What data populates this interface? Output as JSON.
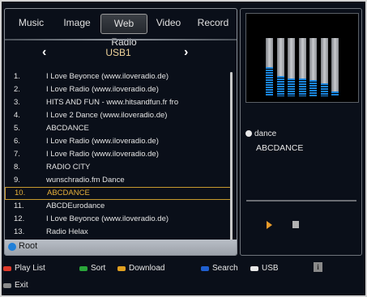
{
  "tabs": [
    {
      "label": "Music"
    },
    {
      "label": "Image"
    },
    {
      "label": "Web Radio"
    },
    {
      "label": "Video"
    },
    {
      "label": "Record"
    }
  ],
  "active_tab": "Web Radio",
  "source": {
    "label": "USB1"
  },
  "list": [
    {
      "num": "1.",
      "title": "I Love Beyonce (www.iloveradio.de)"
    },
    {
      "num": "2.",
      "title": "I Love Radio (www.iloveradio.de)"
    },
    {
      "num": "3.",
      "title": "HITS AND FUN - www.hitsandfun.fr fro"
    },
    {
      "num": "4.",
      "title": "I Love 2 Dance (www.iloveradio.de)"
    },
    {
      "num": "5.",
      "title": "ABCDANCE"
    },
    {
      "num": "6.",
      "title": "I Love Radio (www.iloveradio.de)"
    },
    {
      "num": "7.",
      "title": "I Love Radio (www.iloveradio.de)"
    },
    {
      "num": "8.",
      "title": "RADIO CITY"
    },
    {
      "num": "9.",
      "title": "wunschradio.fm Dance"
    },
    {
      "num": "10.",
      "title": "ABCDANCE"
    },
    {
      "num": "11.",
      "title": "ABCDEurodance"
    },
    {
      "num": "12.",
      "title": "I Love Beyonce (www.iloveradio.de)"
    },
    {
      "num": "13.",
      "title": "Radio Helax"
    }
  ],
  "selected_index": 9,
  "path": {
    "label": "Root"
  },
  "now_playing": {
    "label": "dance",
    "title": "ABCDANCE"
  },
  "visualizer_levels": [
    0.5,
    0.35,
    0.3,
    0.3,
    0.28,
    0.22,
    0.08
  ],
  "progress": 0,
  "bottom": {
    "play_list": "Play List",
    "sort": "Sort",
    "download": "Download",
    "search": "Search",
    "usb": "USB",
    "info": "i",
    "exit": "Exit"
  },
  "colors": {
    "red": "#e03a2a",
    "green": "#2aa63a",
    "yellow": "#e0a020",
    "blue": "#1f5fd0",
    "white": "#e8e8e8",
    "selected": "#e8b23a"
  }
}
